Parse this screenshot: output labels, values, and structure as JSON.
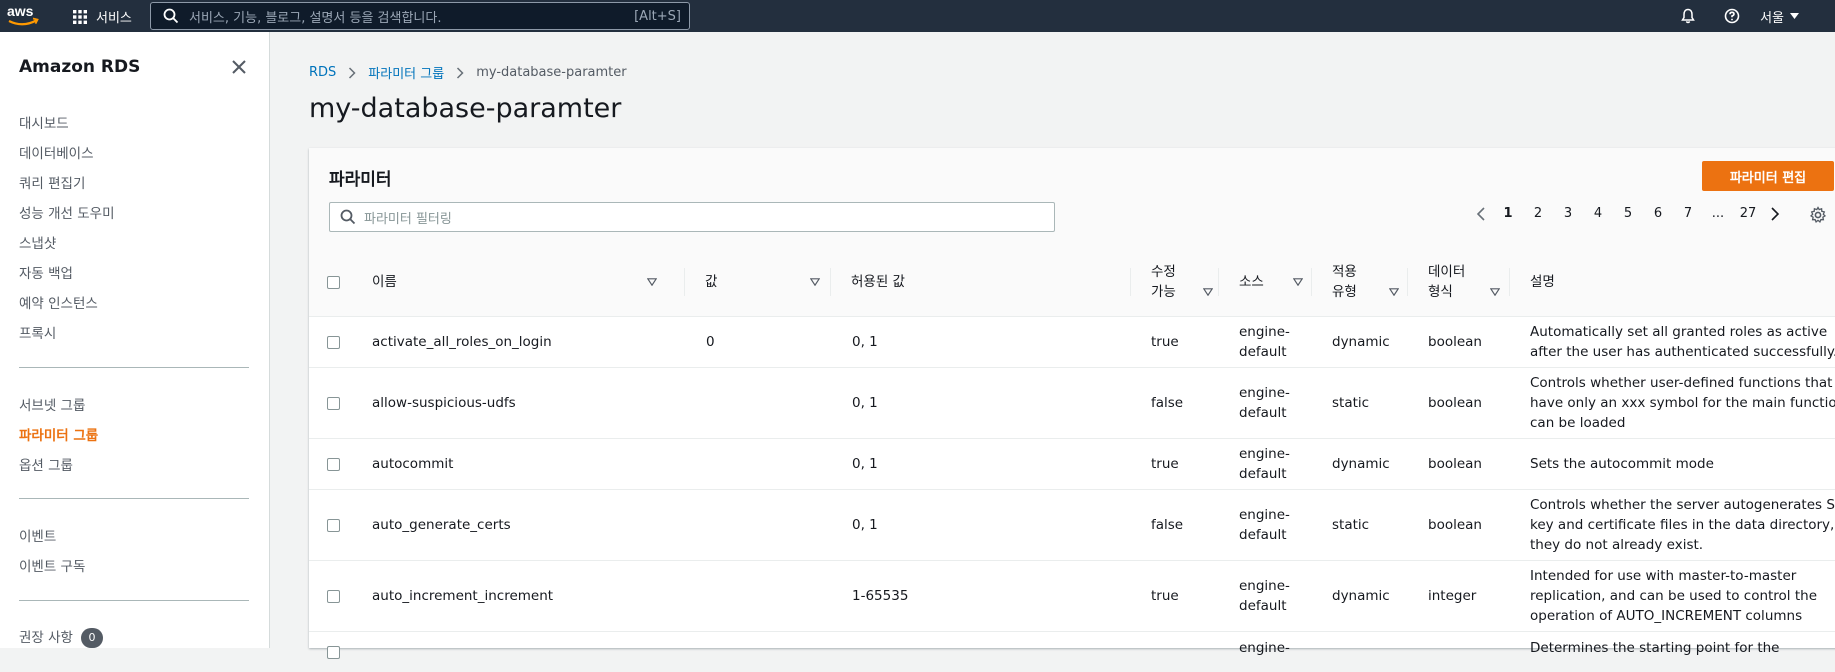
{
  "topbar": {
    "logo_text": "aws",
    "services_label": "서비스",
    "search_placeholder": "서비스, 기능, 블로그, 설명서 등을 검색합니다.",
    "search_shortcut": "[Alt+S]",
    "region_label": "서울"
  },
  "sidebar": {
    "title": "Amazon RDS",
    "group1": [
      "대시보드",
      "데이터베이스",
      "쿼리 편집기",
      "성능 개선 도우미",
      "스냅샷",
      "자동 백업",
      "예약 인스턴스",
      "프록시"
    ],
    "group2": [
      "서브넷 그룹",
      "파라미터 그룹",
      "옵션 그룹"
    ],
    "active_item": "파라미터 그룹",
    "group3": [
      "이벤트",
      "이벤트 구독"
    ],
    "recommendations_label": "권장 사항",
    "recommendations_count": "0"
  },
  "breadcrumb": {
    "items": [
      "RDS",
      "파라미터 그룹",
      "my-database-paramter"
    ]
  },
  "page_title": "my-database-paramter",
  "panel": {
    "title": "파라미터",
    "edit_button": "파라미터 편집",
    "filter_placeholder": "파라미터 필터링",
    "pagination": {
      "pages": [
        "1",
        "2",
        "3",
        "4",
        "5",
        "6",
        "7",
        "...",
        "27"
      ],
      "current": "1"
    }
  },
  "table": {
    "headers": {
      "name": "이름",
      "value": "값",
      "allowed": "허용된 값",
      "modifiable_1": "수정",
      "modifiable_2": "가능",
      "source": "소스",
      "apply_1": "적용",
      "apply_2": "유형",
      "datatype_1": "데이터",
      "datatype_2": "형식",
      "description": "설명"
    },
    "rows": [
      {
        "name": "activate_all_roles_on_login",
        "value": "0",
        "allowed": "0, 1",
        "modifiable": "true",
        "source_1": "engine-",
        "source_2": "default",
        "apply": "dynamic",
        "datatype": "boolean",
        "desc_1": "Automatically set all granted roles as active",
        "desc_2": "after the user has authenticated successfully.",
        "desc_3": ""
      },
      {
        "name": "allow-suspicious-udfs",
        "value": "",
        "allowed": "0, 1",
        "modifiable": "false",
        "source_1": "engine-",
        "source_2": "default",
        "apply": "static",
        "datatype": "boolean",
        "desc_1": "Controls whether user-defined functions that",
        "desc_2": "have only an xxx symbol for the main function",
        "desc_3": "can be loaded"
      },
      {
        "name": "autocommit",
        "value": "",
        "allowed": "0, 1",
        "modifiable": "true",
        "source_1": "engine-",
        "source_2": "default",
        "apply": "dynamic",
        "datatype": "boolean",
        "desc_1": "Sets the autocommit mode",
        "desc_2": "",
        "desc_3": ""
      },
      {
        "name": "auto_generate_certs",
        "value": "",
        "allowed": "0, 1",
        "modifiable": "false",
        "source_1": "engine-",
        "source_2": "default",
        "apply": "static",
        "datatype": "boolean",
        "desc_1": "Controls whether the server autogenerates SSL",
        "desc_2": "key and certificate files in the data directory, if",
        "desc_3": "they do not already exist."
      },
      {
        "name": "auto_increment_increment",
        "value": "",
        "allowed": "1-65535",
        "modifiable": "true",
        "source_1": "engine-",
        "source_2": "default",
        "apply": "dynamic",
        "datatype": "integer",
        "desc_1": "Intended for use with master-to-master",
        "desc_2": "replication, and can be used to control the",
        "desc_3": "operation of AUTO_INCREMENT columns"
      },
      {
        "name": "",
        "value": "",
        "allowed": "",
        "modifiable": "",
        "source_1": "engine-",
        "source_2": "",
        "apply": "",
        "datatype": "",
        "desc_1": "Determines the starting point for the",
        "desc_2": "",
        "desc_3": ""
      }
    ]
  },
  "colors": {
    "topbar_bg": "#232f3e",
    "accent": "#ec7211",
    "link": "#0073bb"
  }
}
